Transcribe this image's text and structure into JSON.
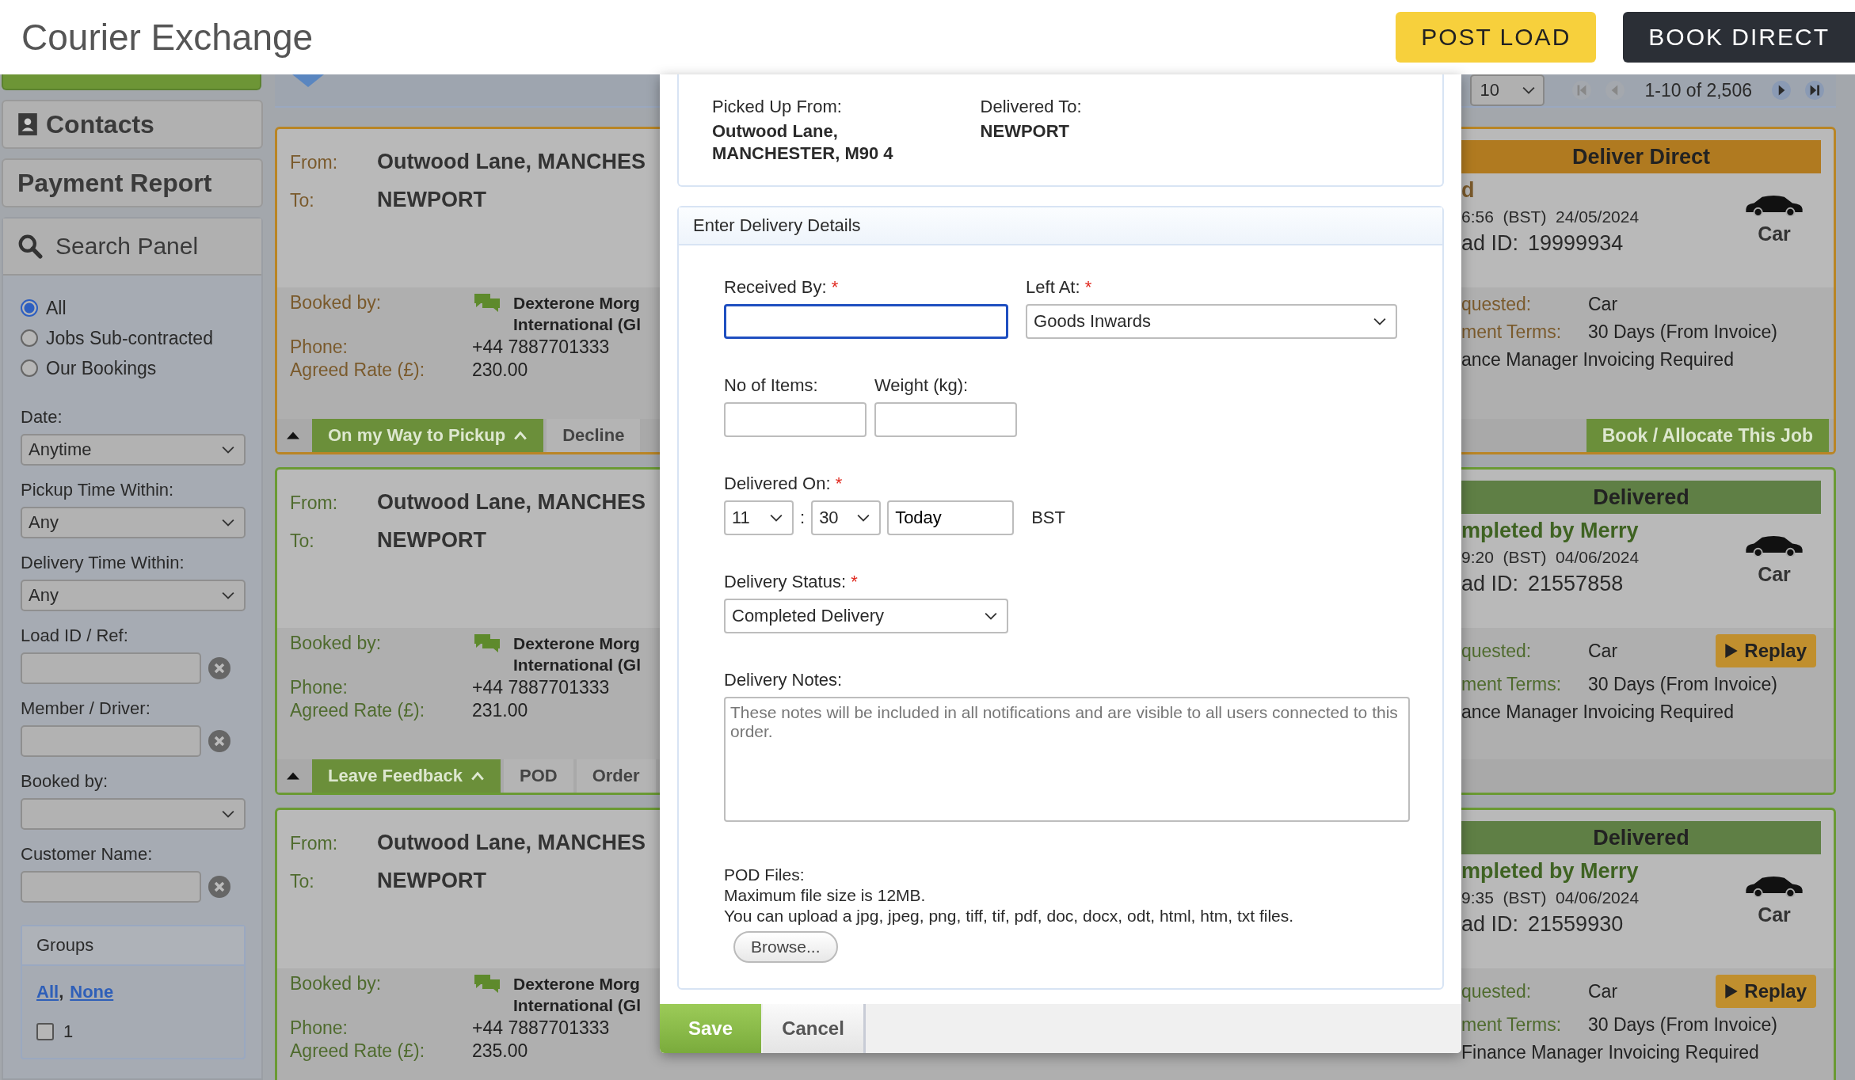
{
  "header": {
    "title": "Courier Exchange",
    "buttons": [
      {
        "label": "POST LOAD",
        "kind": "primary"
      },
      {
        "label": "BOOK DIRECT",
        "kind": "dark"
      }
    ]
  },
  "sidebar": {
    "nav": [
      {
        "label": "Contacts",
        "kind": "contacts"
      },
      {
        "label": "Payment Report",
        "kind": "plain"
      }
    ],
    "search_panel": {
      "title": "Search Panel",
      "filters": [
        {
          "label": "All",
          "selected": true
        },
        {
          "label": "Jobs Sub-contracted",
          "selected": false
        },
        {
          "label": "Our Bookings",
          "selected": false
        }
      ],
      "fields": [
        {
          "label": "Date:",
          "kind": "select",
          "value": "Anytime"
        },
        {
          "label": "Pickup Time Within:",
          "kind": "select",
          "value": "Any"
        },
        {
          "label": "Delivery Time Within:",
          "kind": "select",
          "value": "Any"
        },
        {
          "label": "Load ID / Ref:",
          "kind": "clearable"
        },
        {
          "label": "Member / Driver:",
          "kind": "clearable"
        },
        {
          "label": "Booked by:",
          "kind": "select"
        },
        {
          "label": "Customer Name:",
          "kind": "clearable"
        }
      ],
      "groups": {
        "title": "Groups",
        "links": [
          "All",
          "None"
        ],
        "link_separator": ",",
        "items": [
          {
            "label": "1",
            "checked": false
          }
        ]
      }
    }
  },
  "pager": {
    "page_size": "10",
    "range": "1-10 of 2,506"
  },
  "jobs": [
    {
      "kind": "pending",
      "from_label": "From:",
      "from": "Outwood Lane, MANCHES",
      "to_label": "To:",
      "to": "NEWPORT",
      "booked_by_label": "Booked by:",
      "booked_by": [
        "Dexterone Morg",
        "International (Gl"
      ],
      "phone_label": "Phone:",
      "phone": "+44 7887701333",
      "rate_label": "Agreed Rate (£):",
      "rate": "230.00",
      "actions": [
        {
          "label": "On my Way to Pickup",
          "kind": "primary"
        },
        {
          "label": "Decline",
          "kind": "plain"
        }
      ],
      "status": "Deliver Direct",
      "headline": "d",
      "time": "6:56  (BST)  24/05/2024",
      "load_id_label": "ad ID:",
      "load_id": "19999934",
      "vehicle": "Car",
      "requested_label": "quested:",
      "requested": "Car",
      "terms_label": "ment Terms:",
      "terms": "30 Days (From Invoice)",
      "note": "ance Manager Invoicing Required",
      "book_action": "Book / Allocate This Job"
    },
    {
      "kind": "delivered",
      "from_label": "From:",
      "from": "Outwood Lane, MANCHES",
      "to_label": "To:",
      "to": "NEWPORT",
      "booked_by_label": "Booked by:",
      "booked_by": [
        "Dexterone Morg",
        "International (Gl"
      ],
      "phone_label": "Phone:",
      "phone": "+44 7887701333",
      "rate_label": "Agreed Rate (£):",
      "rate": "231.00",
      "actions": [
        {
          "label": "Leave Feedback",
          "kind": "primary"
        },
        {
          "label": "POD",
          "kind": "plain"
        },
        {
          "label": "Order",
          "kind": "plain"
        }
      ],
      "status": "Delivered",
      "headline": "mpleted by Merry",
      "time": "9:20  (BST)  04/06/2024",
      "load_id_label": "ad ID:",
      "load_id": "21557858",
      "vehicle": "Car",
      "requested_label": "quested:",
      "requested": "Car",
      "replay": "Replay",
      "terms_label": "ment Terms:",
      "terms": "30 Days (From Invoice)",
      "note": "ance Manager Invoicing Required"
    },
    {
      "kind": "delivered",
      "from_label": "From:",
      "from": "Outwood Lane, MANCHES",
      "to_label": "To:",
      "to": "NEWPORT",
      "booked_by_label": "Booked by:",
      "booked_by": [
        "Dexterone Morg",
        "International (Gl"
      ],
      "phone_label": "Phone:",
      "phone": "+44 7887701333",
      "rate_label": "Agreed Rate (£):",
      "rate": "235.00",
      "status": "Delivered",
      "headline": "mpleted by Merry",
      "time": "9:35  (BST)  04/06/2024",
      "load_id_label": "ad ID:",
      "load_id": "21559930",
      "vehicle": "Car",
      "requested_label": "quested:",
      "requested": "Car",
      "replay": "Replay",
      "terms_label": "ment Terms:",
      "terms": "30 Days (From Invoice)",
      "note": "Finance Manager Invoicing Required"
    }
  ],
  "modal": {
    "route": {
      "from_label": "Picked Up From:",
      "from": [
        "Outwood Lane,",
        "MANCHESTER, M90 4"
      ],
      "to_label": "Delivered To:",
      "to": "NEWPORT"
    },
    "details_title": "Enter Delivery Details",
    "required_mark": "*",
    "received_by": {
      "label": "Received By:",
      "focused": true
    },
    "left_at": {
      "label": "Left At:",
      "value": "Goods Inwards"
    },
    "items": {
      "label": "No of Items:"
    },
    "weight": {
      "label": "Weight (kg):"
    },
    "delivered_on": {
      "label": "Delivered On:",
      "hour": "11",
      "separator": ":",
      "minute": "30",
      "date": "Today",
      "zone": "BST"
    },
    "status": {
      "label": "Delivery Status:",
      "value": "Completed Delivery"
    },
    "notes": {
      "label": "Delivery Notes:",
      "placeholder": "These notes will be included in all notifications and are visible to all users connected to this order."
    },
    "pod": {
      "lines": [
        "POD Files:",
        "Maximum file size is 12MB.",
        "You can upload a jpg, jpeg, png, tiff, tif, pdf, doc, docx, odt, html, htm, txt files."
      ],
      "button": "Browse..."
    },
    "buttons": [
      {
        "label": "Save",
        "kind": "primary"
      },
      {
        "label": "Cancel",
        "kind": "plain"
      }
    ]
  }
}
